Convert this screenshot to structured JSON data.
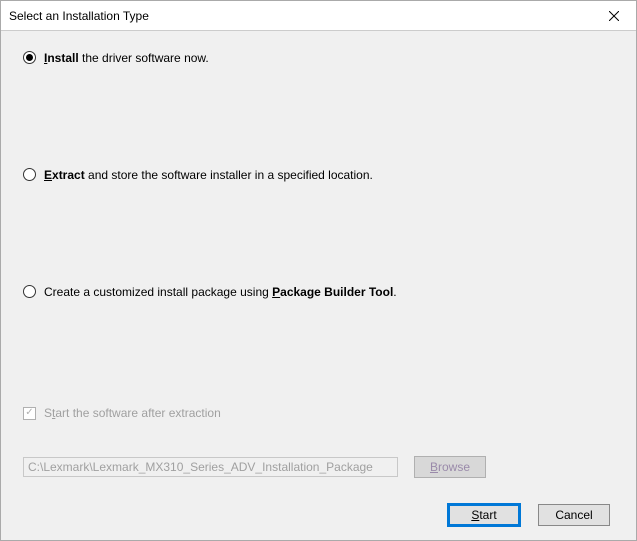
{
  "titlebar": {
    "title": "Select an Installation Type"
  },
  "options": {
    "install": {
      "bold": "Install",
      "rest": " the driver software now.",
      "mnemonic": "I"
    },
    "extract": {
      "bold": "Extract",
      "rest": " and store the software installer in a specified location.",
      "mnemonic": "E"
    },
    "package": {
      "prefix": "Create a customized install package using ",
      "bold": "Package Builder Tool",
      "suffix": ".",
      "mnemonic": "P"
    }
  },
  "checkbox": {
    "mnemonic": "t",
    "label_rest": "art the software after extraction",
    "label_prefix": "S"
  },
  "path": {
    "value": "C:\\Lexmark\\Lexmark_MX310_Series_ADV_Installation_Package"
  },
  "buttons": {
    "browse": {
      "mnemonic": "B",
      "rest": "rowse"
    },
    "start": {
      "mnemonic": "S",
      "rest": "tart"
    },
    "cancel": {
      "label": "Cancel"
    }
  }
}
